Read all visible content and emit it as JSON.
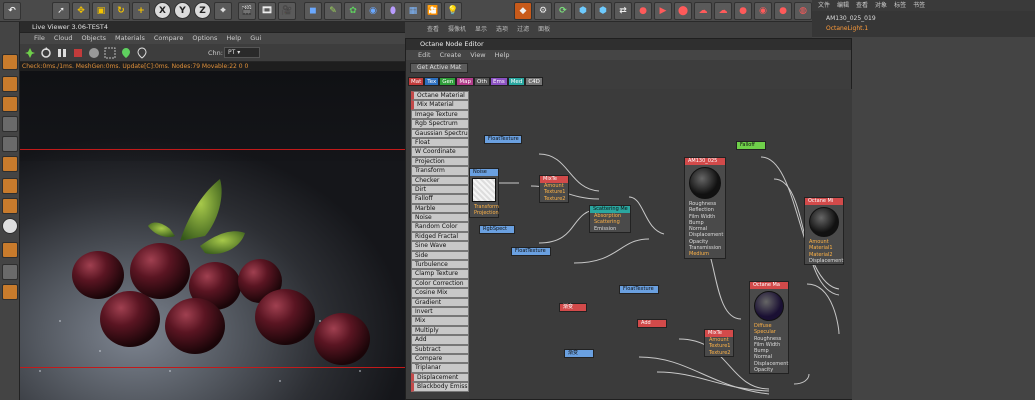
{
  "live_viewer": {
    "title": "Live Viewer 3.06-TEST4",
    "menu": [
      "File",
      "Cloud",
      "Objects",
      "Materials",
      "Compare",
      "Options",
      "Help",
      "Gui"
    ],
    "channel_label": "Chn:",
    "channel_value": "PT",
    "status": "Check:0ms./1ms. MeshGen:0ms. Update[C]:0ms. Nodes:79 Movable:22  0 0"
  },
  "main_menu_cn": [
    "查看",
    "摄像机",
    "显示",
    "选项",
    "过滤",
    "面板"
  ],
  "node_editor": {
    "title": "Octane Node Editor",
    "menu": [
      "Edit",
      "Create",
      "View",
      "Help"
    ],
    "get_active_label": "Get Active Mat",
    "category_tabs": [
      {
        "label": "Mat",
        "color": "#c23b3b"
      },
      {
        "label": "Tex",
        "color": "#2c6fbf"
      },
      {
        "label": "Gen",
        "color": "#2f9e3a"
      },
      {
        "label": "Map",
        "color": "#b23c8a"
      },
      {
        "label": "Oth",
        "color": "#555555"
      },
      {
        "label": "Ems",
        "color": "#8b52c2"
      },
      {
        "label": "Med",
        "color": "#2aa7a0"
      },
      {
        "label": "C4D",
        "color": "#777777"
      }
    ],
    "palette": [
      "Octane Material",
      "Mix Material",
      "Image Texture",
      "Rgb Spectrum",
      "Gaussian Spectrum",
      "Float",
      "W Coordinate",
      "Projection",
      "Transform",
      "Checker",
      "Dirt",
      "Falloff",
      "Marble",
      "Noise",
      "Random Color",
      "Ridged Fractal",
      "Sine Wave",
      "Side",
      "Turbulence",
      "Clamp Texture",
      "Color Correction",
      "Cosine Mix",
      "Gradient",
      "Invert",
      "Mix",
      "Multiply",
      "Add",
      "Subtract",
      "Compare",
      "Triplanar",
      "Displacement",
      "Blackbody Emission"
    ],
    "nodes": {
      "float_texture_1": {
        "title": "FloatTexture"
      },
      "noise": {
        "title": "Noise",
        "pins": [
          "Transform",
          "Projection"
        ]
      },
      "mixtex_1": {
        "title": "MixTe",
        "pins": [
          "Amount",
          "Texture1",
          "Texture2"
        ]
      },
      "rgbspect": {
        "title": "RgbSpect"
      },
      "float_texture_2": {
        "title": "FloatTexture"
      },
      "scattering": {
        "title": "Scattering Me",
        "pins": [
          "Absorption",
          "Scattering",
          "Emission"
        ]
      },
      "am130": {
        "title": "AM130_025",
        "pins": [
          "Roughness",
          "Reflection",
          "Film Width",
          "Bump",
          "Normal",
          "Displacement",
          "Opacity",
          "Transmission",
          "Medium"
        ]
      },
      "falloff": {
        "title": "Falloff"
      },
      "octane_mix": {
        "title": "Octane Mi",
        "pins": [
          "Amount",
          "Material1",
          "Material2",
          "Displacement"
        ]
      },
      "float_texture_3": {
        "title": "FloatTexture"
      },
      "cn_node_1": {
        "title": "渐变"
      },
      "add": {
        "title": "Add"
      },
      "cn_node_2": {
        "title": "渐变"
      },
      "mixtex_2": {
        "title": "MixTe",
        "pins": [
          "Amount",
          "Texture1",
          "Texture2"
        ]
      },
      "octane_mat": {
        "title": "Octane Ma",
        "pins": [
          "Diffuse",
          "Specular",
          "Roughness",
          "Film Width",
          "Bump",
          "Normal",
          "Displacement",
          "Opacity"
        ]
      }
    }
  },
  "right_panel": {
    "menu": [
      "文件",
      "编辑",
      "查看",
      "对象",
      "标签",
      "书签"
    ],
    "objects": [
      "AM130_025_019",
      "OctaneLight.1"
    ]
  },
  "colors": {
    "accent_red": "#c21a1a",
    "status_orange": "#e0903a",
    "wire": "#c8c8c8"
  }
}
